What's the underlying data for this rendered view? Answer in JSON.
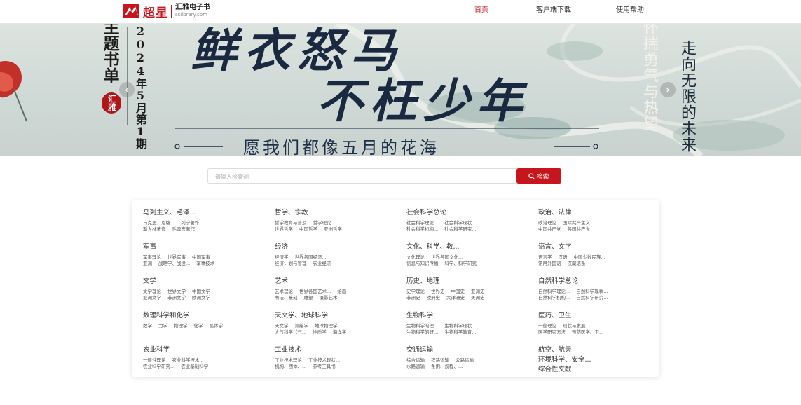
{
  "header": {
    "logo_cn": "超星",
    "logo_name": "汇雅电子书",
    "logo_url": "sslibrary.com",
    "nav": [
      {
        "label": "首页",
        "active": true
      },
      {
        "label": "客户端下载",
        "active": false
      },
      {
        "label": "使用帮助",
        "active": false
      }
    ]
  },
  "banner": {
    "theme_vertical": "主题书单",
    "issue_vertical": "2024年5月第1期",
    "badge": "汇雅",
    "title_line1": "鲜衣怒马",
    "title_line2": "不枉少年",
    "subtitle": "愿我们都像五月的花海",
    "right_vertical_1": "怀揣勇气与热望",
    "right_vertical_2": "走向无限的未来",
    "prev_icon": "‹",
    "next_icon": "›"
  },
  "search": {
    "placeholder": "请输入检索词",
    "value": "",
    "button_label": "检索"
  },
  "categories": [
    {
      "title": "马列主义、毛泽...",
      "subs": [
        [
          "马克思、恩格...",
          "列宁著作"
        ],
        [
          "斯大林著作",
          "毛泽东著作"
        ]
      ]
    },
    {
      "title": "哲学、宗教",
      "subs": [
        [
          "哲学教育与普及",
          "哲学理论"
        ],
        [
          "世界哲学",
          "中国哲学",
          "亚洲哲学"
        ]
      ]
    },
    {
      "title": "社会科学总论",
      "subs": [
        [
          "社会科学理论...",
          "社会科学现状..."
        ],
        [
          "社会科学机构...",
          "社会科学研究..."
        ]
      ]
    },
    {
      "title": "政治、法律",
      "subs": [
        [
          "政治理论",
          "国际共产主义..."
        ],
        [
          "中国共产党",
          "各国共产党"
        ]
      ]
    },
    {
      "title": "军事",
      "subs": [
        [
          "军事理论",
          "世界军事",
          "中国军事"
        ],
        [
          "亚洲",
          "战略学、战役...",
          "军事技术"
        ]
      ]
    },
    {
      "title": "经济",
      "subs": [
        [
          "经济学",
          "世界各国经济..."
        ],
        [
          "经济计划与管理",
          "农业经济"
        ]
      ]
    },
    {
      "title": "文化、科学、教...",
      "subs": [
        [
          "文化理论",
          "世界各国文化..."
        ],
        [
          "信息与知识传播",
          "科学、科学研究"
        ]
      ]
    },
    {
      "title": "语言、文字",
      "subs": [
        [
          "语言学",
          "汉语",
          "中国少数民族..."
        ],
        [
          "常用外国语",
          "汉藏语系"
        ]
      ]
    },
    {
      "title": "文学",
      "subs": [
        [
          "文学理论",
          "世界文学",
          "中国文学"
        ],
        [
          "亚洲文学",
          "非洲文学",
          "欧洲文学"
        ]
      ]
    },
    {
      "title": "艺术",
      "subs": [
        [
          "艺术理论",
          "世界各国艺术...",
          "绘画"
        ],
        [
          "书法、篆刻",
          "雕塑",
          "摄影艺术"
        ]
      ]
    },
    {
      "title": "历史、地理",
      "subs": [
        [
          "史学理论",
          "世界史",
          "中国史",
          "亚洲史"
        ],
        [
          "非洲史",
          "欧洲史",
          "大洋洲史",
          "美洲史"
        ]
      ]
    },
    {
      "title": "自然科学总论",
      "subs": [
        [
          "自然科学理论...",
          "自然科学现状..."
        ],
        [
          "自然科学机构...",
          "自然科学研究..."
        ]
      ]
    },
    {
      "title": "数理科学和化学",
      "subs": [
        [
          "数学",
          "力学",
          "物理学",
          "化学",
          "晶体学"
        ]
      ]
    },
    {
      "title": "天文学、地球科学",
      "subs": [
        [
          "天文学",
          "测绘学",
          "地球物理学"
        ],
        [
          "大气科学（气...",
          "地质学",
          "海洋学"
        ]
      ]
    },
    {
      "title": "生物科学",
      "subs": [
        [
          "生物科学的理...",
          "生物科学现状..."
        ],
        [
          "生物科学的研...",
          "生物科学教育..."
        ]
      ]
    },
    {
      "title": "医药、卫生",
      "subs": [
        [
          "一般理论",
          "现状与发展"
        ],
        [
          "医学研究方法",
          "预防医学、卫..."
        ]
      ]
    },
    {
      "title": "农业科学",
      "subs": [
        [
          "一般性理论",
          "农业科学技术..."
        ],
        [
          "农业科学研究...",
          "农业基础科学"
        ]
      ]
    },
    {
      "title": "工业技术",
      "subs": [
        [
          "工业技术理论",
          "工业技术现状..."
        ],
        [
          "机构、团体、...",
          "参考工具书"
        ]
      ]
    },
    {
      "title": "交通运输",
      "subs": [
        [
          "综合运输",
          "铁路运输",
          "公路运输"
        ],
        [
          "水路运输",
          "条例、规程、..."
        ]
      ]
    },
    {
      "title": "航空、航天",
      "subs": [],
      "extra": [
        "环境科学、安全...",
        "综合性文献"
      ]
    }
  ]
}
